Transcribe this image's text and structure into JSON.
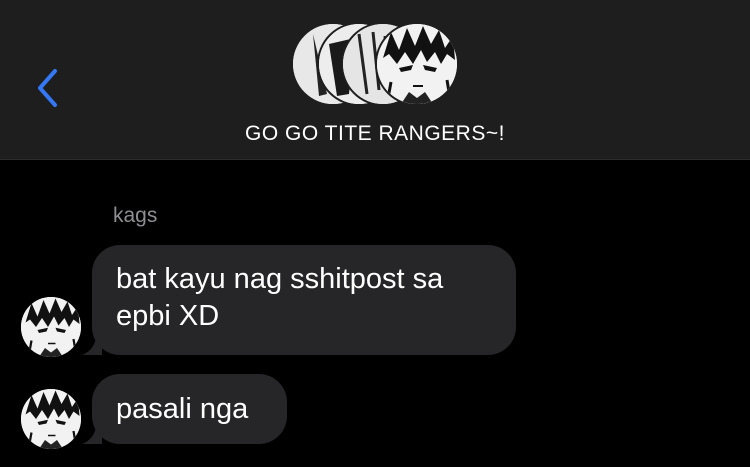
{
  "header": {
    "group_name": "GO GO TITE RANGERS~!",
    "back_icon": "chevron-left-icon",
    "accent_color": "#3478f6"
  },
  "messages": [
    {
      "sender": "kags",
      "text": "bat kayu nag sshitpost sa epbi XD"
    },
    {
      "text": "pasali nga"
    }
  ],
  "colors": {
    "header_bg": "#1e1e1e",
    "bubble_bg": "#262629",
    "sender_text": "#8e8e93"
  }
}
